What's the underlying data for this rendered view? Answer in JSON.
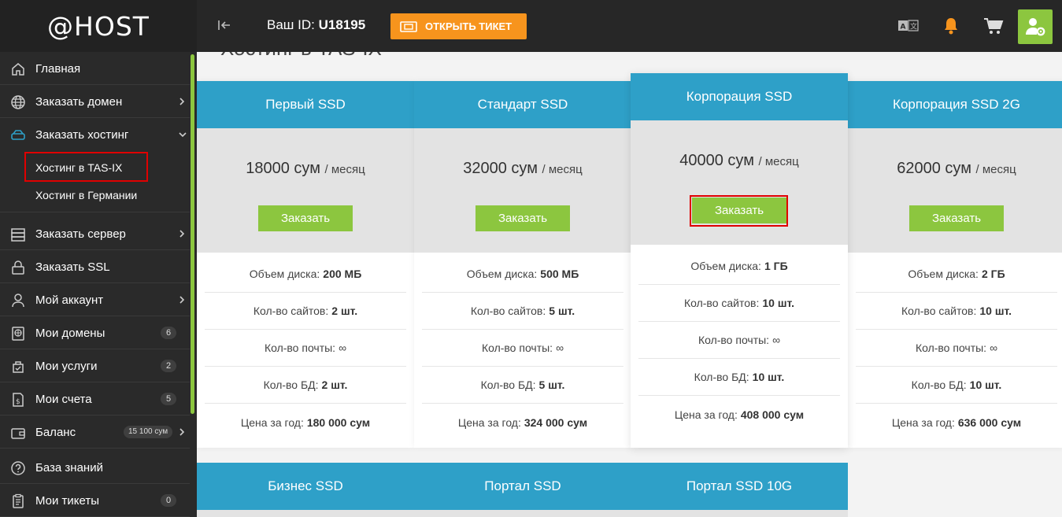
{
  "header": {
    "logo": "@HOST",
    "user_id_label": "Ваш ID:",
    "user_id_value": "U18195",
    "ticket_button": "ОТКРЫТЬ ТИКЕТ",
    "icons": [
      "translate-icon",
      "bell-icon",
      "cart-icon",
      "user-settings-icon"
    ],
    "colors": {
      "accent_orange": "#f7941d",
      "accent_green": "#8cc63f",
      "bar": "#272727"
    }
  },
  "sidebar": {
    "items": [
      {
        "label": "Главная",
        "icon": "home-icon"
      },
      {
        "label": "Заказать домен",
        "icon": "globe-icon"
      },
      {
        "label": "Заказать хостинг",
        "icon": "server-icon"
      },
      {
        "label": "Заказать сервер",
        "icon": "rack-icon"
      },
      {
        "label": "Заказать SSL",
        "icon": "lock-icon"
      },
      {
        "label": "Мой аккаунт",
        "icon": "user-icon"
      },
      {
        "label": "Мои домены",
        "icon": "domain-icon",
        "badge": "6"
      },
      {
        "label": "Мои услуги",
        "icon": "services-icon",
        "badge": "2"
      },
      {
        "label": "Мои счета",
        "icon": "invoice-icon",
        "badge": "5"
      },
      {
        "label": "Баланс",
        "icon": "wallet-icon",
        "badge": "15 100 сум"
      },
      {
        "label": "База знаний",
        "icon": "question-icon"
      },
      {
        "label": "Мои тикеты",
        "icon": "ticket-list-icon",
        "badge": "0"
      }
    ],
    "subitems": [
      {
        "label": "Хостинг в TAS-IX"
      },
      {
        "label": "Хостинг в Германии"
      }
    ]
  },
  "main": {
    "title": "Хостинг в TAS-IX",
    "order_label": "Заказать",
    "price_unit": "/ месяц",
    "feature_labels": {
      "disk": "Объем диска:",
      "sites": "Кол-во сайтов:",
      "mail": "Кол-во почты:",
      "db": "Кол-во БД:",
      "year": "Цена за год:"
    },
    "plans": [
      {
        "name": "Первый SSD",
        "price": "18000 сум",
        "disk": "200 МБ",
        "sites": "2 шт.",
        "mail": "∞",
        "db": "2 шт.",
        "year": "180 000 сум"
      },
      {
        "name": "Стандарт SSD",
        "price": "32000 сум",
        "disk": "500 МБ",
        "sites": "5 шт.",
        "mail": "∞",
        "db": "5 шт.",
        "year": "324 000 сум"
      },
      {
        "name": "Корпорация SSD",
        "price": "40000 сум",
        "disk": "1 ГБ",
        "sites": "10 шт.",
        "mail": "∞",
        "db": "10 шт.",
        "year": "408 000 сум"
      },
      {
        "name": "Корпорация SSD 2G",
        "price": "62000 сум",
        "disk": "2 ГБ",
        "sites": "10 шт.",
        "mail": "∞",
        "db": "10 шт.",
        "year": "636 000 сум"
      }
    ],
    "plans_row2": [
      {
        "name": "Бизнес SSD"
      },
      {
        "name": "Портал SSD"
      },
      {
        "name": "Портал SSD 10G"
      }
    ]
  }
}
